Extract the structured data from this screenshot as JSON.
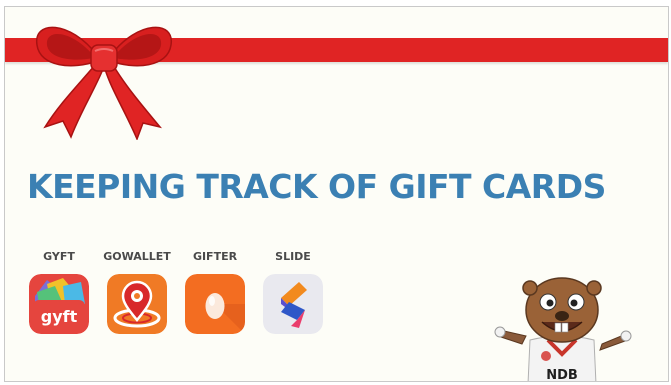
{
  "title": "KEEPING TRACK OF GIFT CARDS",
  "apps": [
    {
      "label": "GYFT",
      "icon": "gyft-app-icon",
      "icon_text": "gyft",
      "color": "#e5453e"
    },
    {
      "label": "GOWALLET",
      "icon": "gowallet-app-icon",
      "color": "#f07a25"
    },
    {
      "label": "GIFTER",
      "icon": "gifter-app-icon",
      "color": "#f36d21"
    },
    {
      "label": "SLIDE",
      "icon": "slide-app-icon",
      "color": "#e9e9ef"
    }
  ],
  "mascot": {
    "badge_text": "NDB"
  },
  "colors": {
    "ribbon": "#e02424",
    "title": "#3b80b3",
    "background": "#fdfdf7"
  }
}
